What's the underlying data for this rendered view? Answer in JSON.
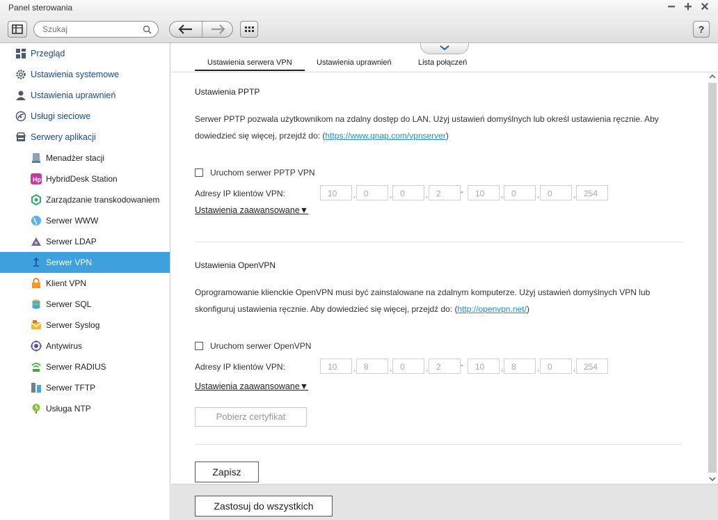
{
  "window": {
    "title": "Panel sterowania"
  },
  "toolbar": {
    "search_placeholder": "Szukaj"
  },
  "sidebar": {
    "items": [
      {
        "label": "Przegląd",
        "icon": "grid-icon",
        "level": "top"
      },
      {
        "label": "Ustawienia systemowe",
        "icon": "gear-icon",
        "level": "top"
      },
      {
        "label": "Ustawienia uprawnień",
        "icon": "user-icon",
        "level": "top"
      },
      {
        "label": "Usługi sieciowe",
        "icon": "network-icon",
        "level": "top"
      },
      {
        "label": "Serwery aplikacji",
        "icon": "server-icon",
        "level": "top"
      },
      {
        "label": "Menadżer stacji",
        "icon": "station-icon",
        "level": "sub"
      },
      {
        "label": "HybridDesk Station",
        "icon": "hybriddesk-icon",
        "level": "sub"
      },
      {
        "label": "Zarządzanie transkodowaniem",
        "icon": "transcode-icon",
        "level": "sub"
      },
      {
        "label": "Serwer WWW",
        "icon": "globe-icon",
        "level": "sub"
      },
      {
        "label": "Serwer LDAP",
        "icon": "ldap-icon",
        "level": "sub"
      },
      {
        "label": "Serwer VPN",
        "icon": "vpn-icon",
        "level": "sub",
        "active": true
      },
      {
        "label": "Klient VPN",
        "icon": "lock-icon",
        "level": "sub"
      },
      {
        "label": "Serwer SQL",
        "icon": "database-icon",
        "level": "sub"
      },
      {
        "label": "Serwer Syslog",
        "icon": "syslog-icon",
        "level": "sub"
      },
      {
        "label": "Antywirus",
        "icon": "antivirus-icon",
        "level": "sub"
      },
      {
        "label": "Serwer RADIUS",
        "icon": "radius-icon",
        "level": "sub"
      },
      {
        "label": "Serwer TFTP",
        "icon": "tftp-icon",
        "level": "sub"
      },
      {
        "label": "Usługa NTP",
        "icon": "ntp-icon",
        "level": "sub"
      }
    ]
  },
  "tabs": [
    {
      "label": "Ustawienia serwera VPN",
      "active": true
    },
    {
      "label": "Ustawienia uprawnień"
    },
    {
      "label": "Lista połączeń"
    }
  ],
  "pptp": {
    "title": "Ustawienia PPTP",
    "desc_text": "Serwer PPTP pozwala użytkownikom na zdalny dostęp do LAN. Użyj ustawień domyślnych lub określ ustawienia ręcznie. Aby dowiedzieć się więcej, przejdź do: (",
    "desc_link": "https://www.qnap.com/vpnserver",
    "desc_end": ")",
    "enable_label": "Uruchom serwer PPTP VPN",
    "ip_label": "Adresy IP klientów VPN:",
    "ip_start": [
      "10",
      "0",
      "0",
      "2"
    ],
    "ip_end": [
      "10",
      "0",
      "0",
      "254"
    ],
    "advanced": "Ustawienia zaawansowane▼"
  },
  "openvpn": {
    "title": "Ustawienia OpenVPN",
    "desc_text": "Oprogramowanie klienckie OpenVPN musi być zainstalowane na zdalnym komputerze. Użyj ustawień domyślnych VPN lub skonfiguruj ustawienia ręcznie. Aby dowiedzieć się więcej, przejdź do: (",
    "desc_link": "http://openvpn.net/",
    "desc_end": ")",
    "enable_label": "Uruchom serwer OpenVPN",
    "ip_label": "Adresy IP klientów VPN:",
    "ip_start": [
      "10",
      "8",
      "0",
      "2"
    ],
    "ip_end": [
      "10",
      "8",
      "0",
      "254"
    ],
    "advanced": "Ustawienia zaawansowane▼",
    "download_cert": "Pobierz certyfikat"
  },
  "buttons": {
    "save": "Zapisz",
    "apply_all": "Zastosuj do wszystkich"
  }
}
